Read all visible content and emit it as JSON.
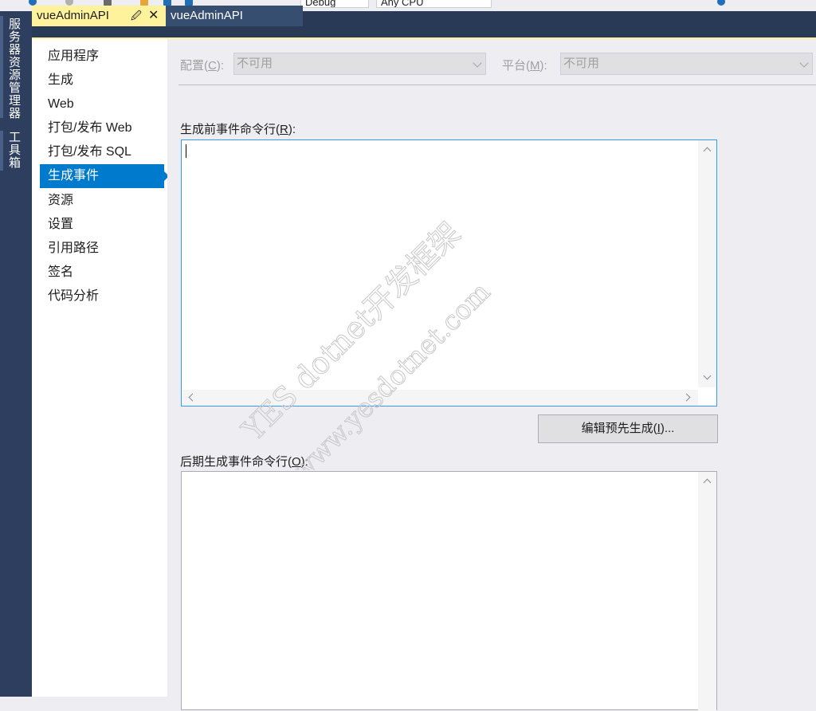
{
  "toolbar": {
    "configuration_value": "Debug",
    "platform_value": "Any CPU"
  },
  "side_dock": {
    "items": [
      {
        "label": "服务器资源管理器"
      },
      {
        "label": "工具箱"
      }
    ]
  },
  "tabs": [
    {
      "label": "vueAdminAPI",
      "active": true
    },
    {
      "label": "vueAdminAPI",
      "active": false
    }
  ],
  "nav": {
    "items": [
      {
        "label": "应用程序"
      },
      {
        "label": "生成"
      },
      {
        "label": "Web"
      },
      {
        "label": "打包/发布 Web"
      },
      {
        "label": "打包/发布 SQL"
      },
      {
        "label": "生成事件",
        "selected": true
      },
      {
        "label": "资源"
      },
      {
        "label": "设置"
      },
      {
        "label": "引用路径"
      },
      {
        "label": "签名"
      },
      {
        "label": "代码分析"
      }
    ]
  },
  "config_bar": {
    "config_label_prefix": "配置(",
    "config_label_key": "C",
    "config_label_suffix": "):",
    "config_value": "不可用",
    "platform_label_prefix": "平台(",
    "platform_label_key": "M",
    "platform_label_suffix": "):",
    "platform_value": "不可用"
  },
  "pre_build": {
    "label_prefix": "生成前事件命令行(",
    "label_key": "R",
    "label_suffix": "):",
    "value": "",
    "edit_button_prefix": "编辑预先生成(",
    "edit_button_key": "I",
    "edit_button_suffix": ")..."
  },
  "post_build": {
    "label_prefix": "后期生成事件命令行(",
    "label_key": "O",
    "label_suffix": "):",
    "value": ""
  },
  "watermark": {
    "line1": "YES dotnet开发框架",
    "line2": "www.yesdotnet.com"
  },
  "colors": {
    "accent": "#007ACC",
    "active_tab": "#FFF29D",
    "dock": "#2D3E5E"
  }
}
